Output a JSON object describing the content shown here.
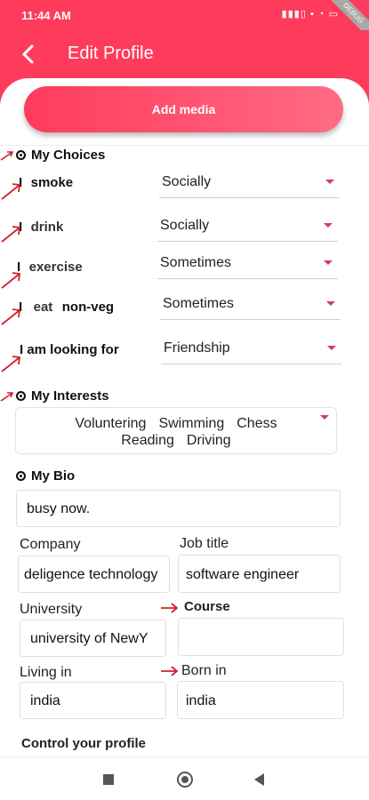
{
  "status": {
    "time": "11:44 AM",
    "system_icons": "▮▮▮▯ ▪ ◔ ▭",
    "debug_banner": "DEBUG"
  },
  "header": {
    "title": "Edit Profile",
    "back_icon": "back-arrow-icon"
  },
  "add_media": {
    "label": "Add media"
  },
  "choices": {
    "heading": "My Choices",
    "rows": [
      {
        "prefix": "I",
        "label": "smoke",
        "value": "Socially"
      },
      {
        "prefix": "I",
        "label": "drink",
        "value": "Socially"
      },
      {
        "prefix": "I",
        "label": "exercise",
        "value": "Sometimes"
      },
      {
        "prefix": "I",
        "label": "eat",
        "suffix": "non-veg",
        "value": "Sometimes"
      },
      {
        "prefix": "",
        "label": "I am looking for",
        "value": "Friendship"
      }
    ]
  },
  "interests": {
    "heading": "My Interests",
    "items": [
      "Voluntering",
      "Swimming",
      "Chess",
      "Reading",
      "Driving"
    ]
  },
  "bio": {
    "heading": "My Bio",
    "value": "busy now."
  },
  "work": {
    "company_label": "Company",
    "company_value": "deligence technology",
    "job_label": "Job title",
    "job_value": "software engineer"
  },
  "education": {
    "university_label": "University",
    "university_value": "university of NewY",
    "course_label": "Course",
    "course_value": ""
  },
  "location": {
    "living_label": "Living in",
    "living_value": "india",
    "born_label": "Born in",
    "born_value": "india"
  },
  "control": {
    "heading": "Control your profile"
  },
  "colors": {
    "accent": "#ff3b5c",
    "caret": "#d93a56",
    "annotation": "#d0202a"
  }
}
